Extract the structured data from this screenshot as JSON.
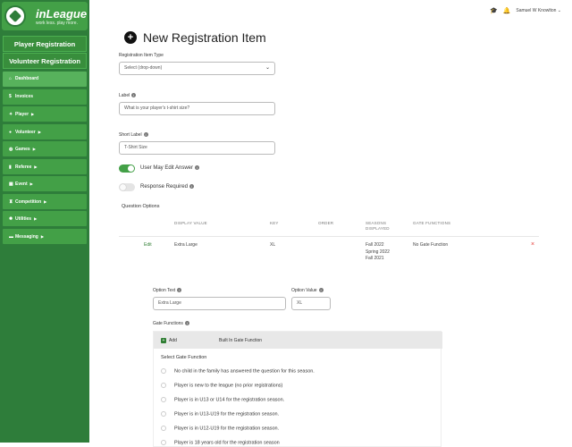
{
  "app": {
    "logo_title": "inLeague",
    "logo_tagline": "work less. play more."
  },
  "sidebar": {
    "primary_buttons": [
      "Player Registration",
      "Volunteer Registration"
    ],
    "items": [
      {
        "label": "Dashboard",
        "icon": "home-icon",
        "glyph": "⌂",
        "has_caret": false,
        "active": true
      },
      {
        "label": "Invoices",
        "icon": "dollar-icon",
        "glyph": "$",
        "has_caret": false,
        "active": false
      },
      {
        "label": "Player",
        "icon": "runner-icon",
        "glyph": "✦",
        "has_caret": true,
        "active": false
      },
      {
        "label": "Volunteer",
        "icon": "person-icon",
        "glyph": "●",
        "has_caret": true,
        "active": false
      },
      {
        "label": "Games",
        "icon": "ball-icon",
        "glyph": "◍",
        "has_caret": true,
        "active": false
      },
      {
        "label": "Referee",
        "icon": "card-icon",
        "glyph": "▮",
        "has_caret": true,
        "active": false
      },
      {
        "label": "Event",
        "icon": "calendar-icon",
        "glyph": "▦",
        "has_caret": true,
        "active": false
      },
      {
        "label": "Competition",
        "icon": "trophy-icon",
        "glyph": "♜",
        "has_caret": true,
        "active": false
      },
      {
        "label": "Utilities",
        "icon": "gear-icon",
        "glyph": "✹",
        "has_caret": true,
        "active": false
      },
      {
        "label": "Messaging",
        "icon": "chat-icon",
        "glyph": "▬",
        "has_caret": true,
        "active": false
      }
    ]
  },
  "topbar": {
    "user_name": "Samuel W Knowlton",
    "caret": "⌄"
  },
  "page": {
    "title": "New Registration Item"
  },
  "form": {
    "item_type_label": "Registration Item Type",
    "item_type_value": "Select (drop-down)",
    "label_label": "Label",
    "label_value": "What is your player's t-shirt size?",
    "short_label_label": "Short Label",
    "short_label_value": "T-Shirt Size",
    "user_may_edit_label": "User May Edit Answer",
    "user_may_edit_on": true,
    "response_required_label": "Response Required",
    "response_required_on": false
  },
  "question_options": {
    "heading": "Question Options",
    "columns": [
      "DISPLAY VALUE",
      "KEY",
      "ORDER",
      "SEASONS DISPLAYED",
      "GATE FUNCTIONS"
    ],
    "rows": [
      {
        "edit_label": "Edit",
        "display_value": "Extra Large",
        "key": "XL",
        "order": "",
        "seasons": [
          "Fall 2022",
          "Spring 2022",
          "Fall 2021"
        ],
        "gate_functions": "No Gate Function",
        "delete_glyph": "×"
      }
    ]
  },
  "option_editor": {
    "option_text_label": "Option Text",
    "option_text_value": "Extra Large",
    "option_value_label": "Option Value",
    "option_value_value": "XL",
    "gate_functions_label": "Gate Functions",
    "add_label": "Add",
    "built_in_label": "Built In Gate Function",
    "select_label": "Select Gate Function",
    "options": [
      "No child in the family has answered the question for this season.",
      "Player is new to the league (no prior registrations)",
      "Player is in U13 or U14 for the registration season.",
      "Player is in U13-U19 for the registration season.",
      "Player is in U12-U19 for the registration season.",
      "Player is 18 years old for the registration season"
    ]
  },
  "colors": {
    "brand_green": "#2e7d3a",
    "nav_green": "#43a047",
    "delete_red": "#e53935"
  }
}
